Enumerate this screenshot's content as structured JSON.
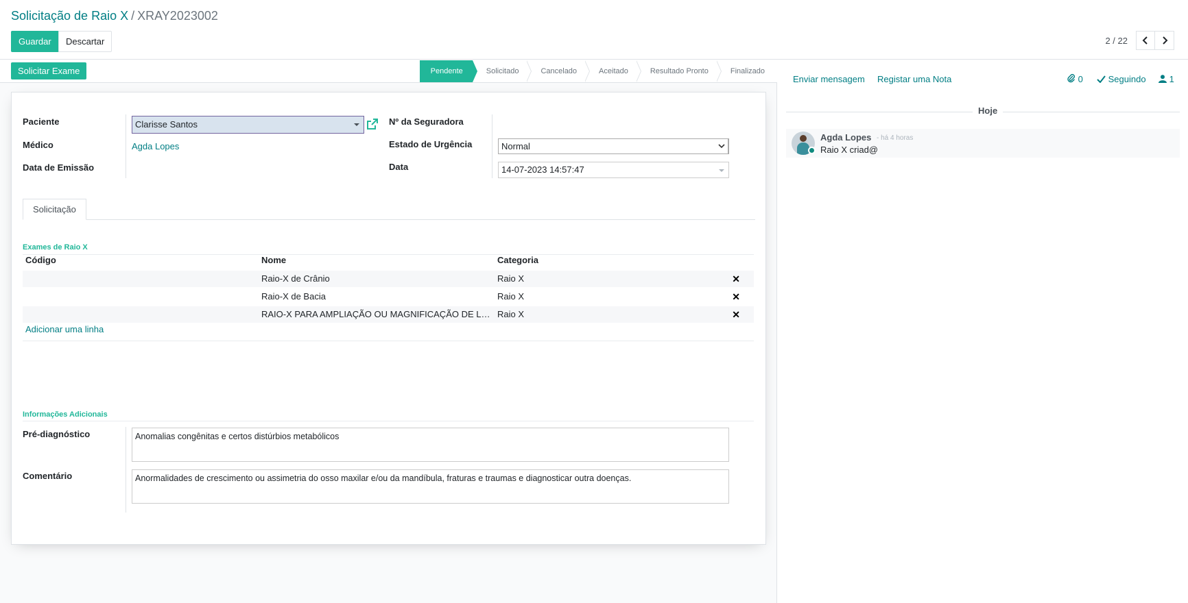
{
  "breadcrumb": {
    "parent": "Solicitação de Raio X",
    "separator": "/",
    "current": "XRAY2023002"
  },
  "toolbar": {
    "save_label": "Guardar",
    "discard_label": "Descartar"
  },
  "pager": {
    "value": "2 / 22",
    "prev_icon": "chevron-left-icon",
    "next_icon": "chevron-right-icon"
  },
  "statusbar": {
    "request_button": "Solicitar Exame",
    "stages": [
      "Pendente",
      "Solicitado",
      "Cancelado",
      "Aceitado",
      "Resultado Pronto",
      "Finalizado"
    ],
    "active_stage": "Pendente"
  },
  "form": {
    "patient_label": "Paciente",
    "patient_value": "Clarisse Santos",
    "doctor_label": "Médico",
    "doctor_value": "Agda Lopes",
    "issue_date_label": "Data de Emissão",
    "insurer_label": "Nº da Seguradora",
    "urgency_label": "Estado de Urgência",
    "urgency_value": "Normal",
    "date_label": "Data",
    "date_value": "14-07-2023 14:57:47"
  },
  "tabs": [
    {
      "label": "Solicitação"
    }
  ],
  "exams": {
    "section_title": "Exames de Raio X",
    "columns": [
      "Código",
      "Nome",
      "Categoria"
    ],
    "rows": [
      {
        "code": "",
        "name": "Raio-X de Crânio",
        "category": "Raio X"
      },
      {
        "code": "",
        "name": "Raio-X de Bacia",
        "category": "Raio X"
      },
      {
        "code": "",
        "name": "RAIO-X PARA AMPLIAÇÃO OU MAGNIFICAÇÃO DE LESÃO",
        "category": "Raio X"
      }
    ],
    "add_line": "Adicionar uma linha",
    "delete_icon": "close-icon"
  },
  "additional": {
    "section_title": "Informações Adicionais",
    "prediagnosis_label": "Pré-diagnóstico",
    "prediagnosis_value": "Anomalias congênitas e  certos distúrbios metabólicos",
    "comment_label": "Comentário",
    "comment_value": "Anormalidades de crescimento ou assimetria do osso maxilar e/ou da mandíbula, fraturas e traumas e diagnosticar outra doenças."
  },
  "chatter": {
    "send_message": "Enviar mensagem",
    "log_note": "Registar uma Nota",
    "attachments_count": "0",
    "following_label": "Seguindo",
    "followers_count": "1",
    "day_separator": "Hoje",
    "messages": [
      {
        "author": "Agda Lopes",
        "date": "- há 4 horas",
        "body": "Raio X criad@"
      }
    ]
  },
  "colors": {
    "primary": "#21b799",
    "link": "#017e84",
    "selected_field": "#d8e3ee"
  }
}
